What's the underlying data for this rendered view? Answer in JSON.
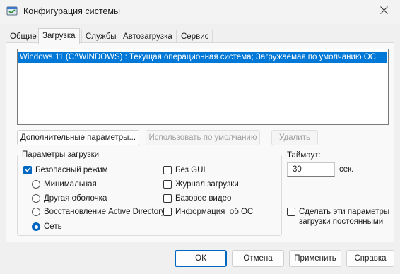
{
  "window": {
    "title": "Конфигурация системы"
  },
  "tabs": [
    {
      "label": "Общие",
      "active": false
    },
    {
      "label": "Загрузка",
      "active": true
    },
    {
      "label": "Службы",
      "active": false
    },
    {
      "label": "Автозагрузка",
      "active": false
    },
    {
      "label": "Сервис",
      "active": false
    }
  ],
  "os_list": {
    "items": [
      {
        "label": "Windows 11 (C:\\WINDOWS) : Текущая операционная система; Загружаемая по умолчанию ОС",
        "selected": true
      }
    ]
  },
  "list_buttons": {
    "advanced": "Дополнительные параметры...",
    "set_default": "Использовать по умолчанию",
    "delete": "Удалить"
  },
  "boot_options": {
    "group_label": "Параметры загрузки",
    "safe_boot": {
      "label": "Безопасный режим",
      "checked": true
    },
    "minimal": {
      "label": "Минимальная",
      "checked": false
    },
    "alternate_shell": {
      "label": "Другая оболочка",
      "checked": false
    },
    "ad_repair": {
      "label": "Восстановление Active Directory",
      "checked": false
    },
    "network": {
      "label": "Сеть",
      "checked": true
    },
    "no_gui": {
      "label": "Без GUI",
      "checked": false
    },
    "boot_log": {
      "label": "Журнал загрузки",
      "checked": false
    },
    "base_video": {
      "label": "Базовое видео",
      "checked": false
    },
    "os_info": {
      "label": "Информация  об ОС",
      "checked": false
    }
  },
  "timeout": {
    "label": "Таймаут:",
    "value": "30",
    "unit": "сек."
  },
  "permanent": {
    "line1": "Сделать эти параметры",
    "line2": "загрузки постоянными",
    "checked": false
  },
  "dialog_buttons": {
    "ok": "ОК",
    "cancel": "Отмена",
    "apply": "Применить",
    "help": "Справка"
  },
  "colors": {
    "accent": "#0067c0",
    "selection": "#0078d7"
  },
  "icons": {
    "app": "msconfig-icon",
    "close": "close-icon",
    "check": "check-icon"
  }
}
